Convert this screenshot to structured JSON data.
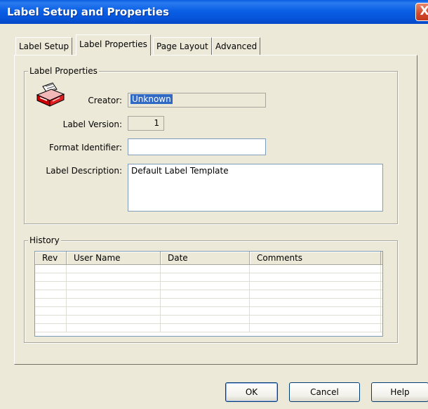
{
  "window": {
    "title": "Label Setup and Properties",
    "close_glyph": "X"
  },
  "tabs": [
    {
      "label": "Label Setup",
      "active": false
    },
    {
      "label": "Label Properties",
      "active": true
    },
    {
      "label": "Page Layout",
      "active": false
    },
    {
      "label": "Advanced",
      "active": false
    }
  ],
  "label_properties": {
    "group_title": "Label Properties",
    "icon": "label-printer-icon",
    "creator_label": "Creator:",
    "creator_value": "Unknown",
    "version_label": "Label Version:",
    "version_value": "1",
    "format_label": "Format Identifier:",
    "format_value": "",
    "description_label": "Label Description:",
    "description_value": "Default Label Template"
  },
  "history": {
    "group_title": "History",
    "columns": [
      "Rev",
      "User Name",
      "Date",
      "Comments"
    ],
    "empty_rows": 8
  },
  "buttons": {
    "ok": "OK",
    "cancel": "Cancel",
    "help": "Help"
  },
  "colors": {
    "titlebar": "#0A5FE4",
    "selection": "#316AC5",
    "dialog_bg": "#ECE9D8",
    "close": "#D2472A"
  }
}
